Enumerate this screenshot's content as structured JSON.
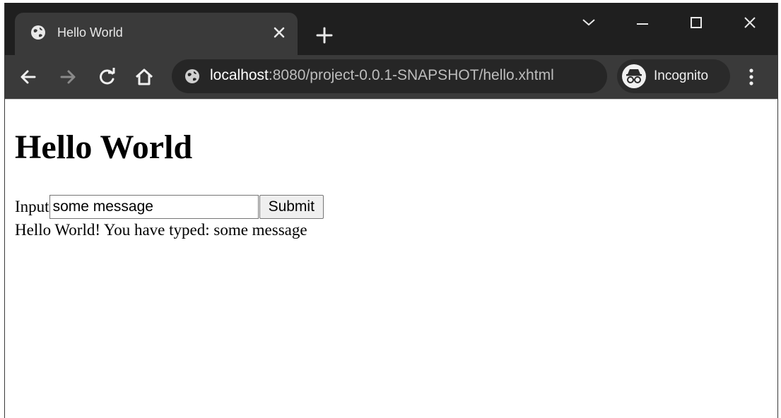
{
  "browser": {
    "tab": {
      "title": "Hello World"
    },
    "address_bar": {
      "host": "localhost",
      "rest": ":8080/project-0.0.1-SNAPSHOT/hello.xhtml"
    },
    "profile": {
      "label": "Incognito"
    }
  },
  "page": {
    "heading": "Hello World",
    "form": {
      "label": "Input",
      "input_value": "some message",
      "submit_label": "Submit"
    },
    "output": "Hello World! You have typed: some message"
  }
}
